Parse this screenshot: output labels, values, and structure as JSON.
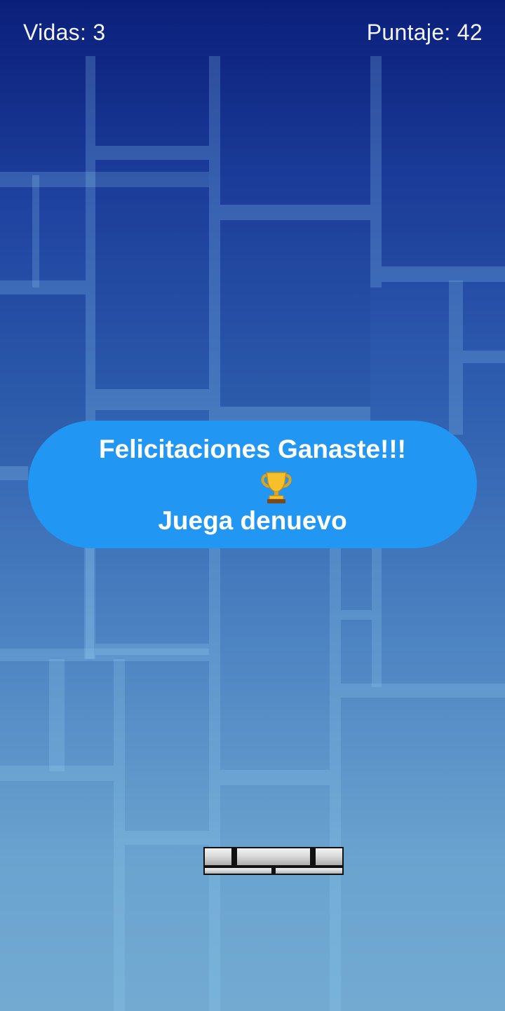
{
  "hud": {
    "lives_text": "Vidas: 3",
    "score_text": "Puntaje: 42"
  },
  "dialog": {
    "title": "Felicitaciones Ganaste!!!",
    "action": "Juega denuevo",
    "icon": "trophy-icon",
    "color": "#2196f3"
  },
  "theme": {
    "background_top": "#0a1f7a",
    "background_bottom": "#72aad2",
    "text_color": "#f2f4ff"
  }
}
